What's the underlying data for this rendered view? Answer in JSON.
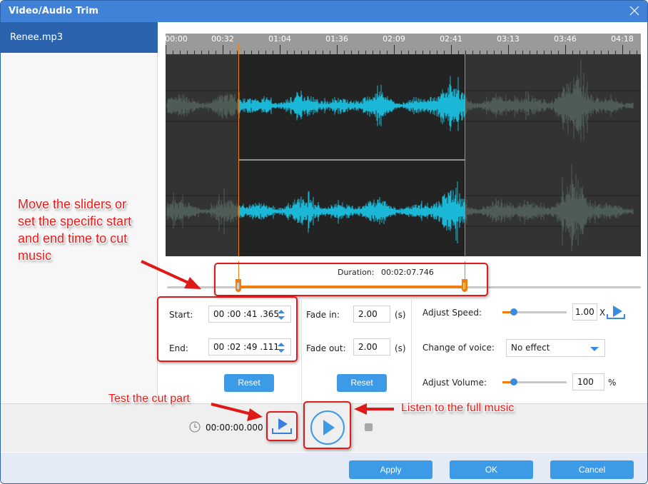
{
  "window": {
    "title": "Video/Audio Trim",
    "close_icon": "close-icon"
  },
  "sidebar": {
    "files": [
      {
        "label": "Renee.mp3",
        "selected": true
      }
    ]
  },
  "timeline": {
    "labels": [
      "00:00",
      "00:32",
      "01:04",
      "01:36",
      "02:09",
      "02:41",
      "03:13",
      "03:46",
      "04:18"
    ],
    "selection_start_label_time": "00:00:41.365",
    "selection_end_label_time": "00:02:49.111"
  },
  "waveform": {
    "channels": 2,
    "selected_color": "#1ab8d6",
    "unselected_color": "#4e5c55",
    "marker_color": "#f07d10"
  },
  "trim": {
    "duration_label": "Duration:",
    "duration_value": "00:02:07.746",
    "selection_start_fraction": 0.153,
    "selection_end_fraction": 0.629
  },
  "cut": {
    "start_label": "Start:",
    "start_value": "00 :00 :41 .365",
    "end_label": "End:",
    "end_value": "00 :02 :49 .111",
    "reset_label": "Reset"
  },
  "fade": {
    "fade_in_label": "Fade in:",
    "fade_in_value": "2.00",
    "fade_out_label": "Fade out:",
    "fade_out_value": "2.00",
    "unit": "(s)",
    "reset_label": "Reset"
  },
  "effects": {
    "speed_label": "Adjust Speed:",
    "speed_value": "1.00",
    "speed_unit": "X",
    "speed_slider_fraction": 0.18,
    "voice_label": "Change of voice:",
    "voice_value": "No effect",
    "volume_label": "Adjust Volume:",
    "volume_value": "100",
    "volume_unit": "%",
    "volume_slider_fraction": 0.18
  },
  "playback": {
    "current_time": "00:00:00.000"
  },
  "footer": {
    "apply_label": "Apply",
    "ok_label": "OK",
    "cancel_label": "Cancel"
  },
  "annotations": {
    "sliders_note": [
      "Move the sliders or",
      "set the specific start",
      "and end time to cut",
      "music"
    ],
    "test_cut_note": "Test the cut part",
    "full_music_note": "Listen to the full music"
  },
  "colors": {
    "titlebar": "#3f82d8",
    "accent_button": "#3c9ae6",
    "sidebar_selected": "#2b63ae",
    "orange": "#f07d10",
    "annotation_red": "#e01818"
  }
}
